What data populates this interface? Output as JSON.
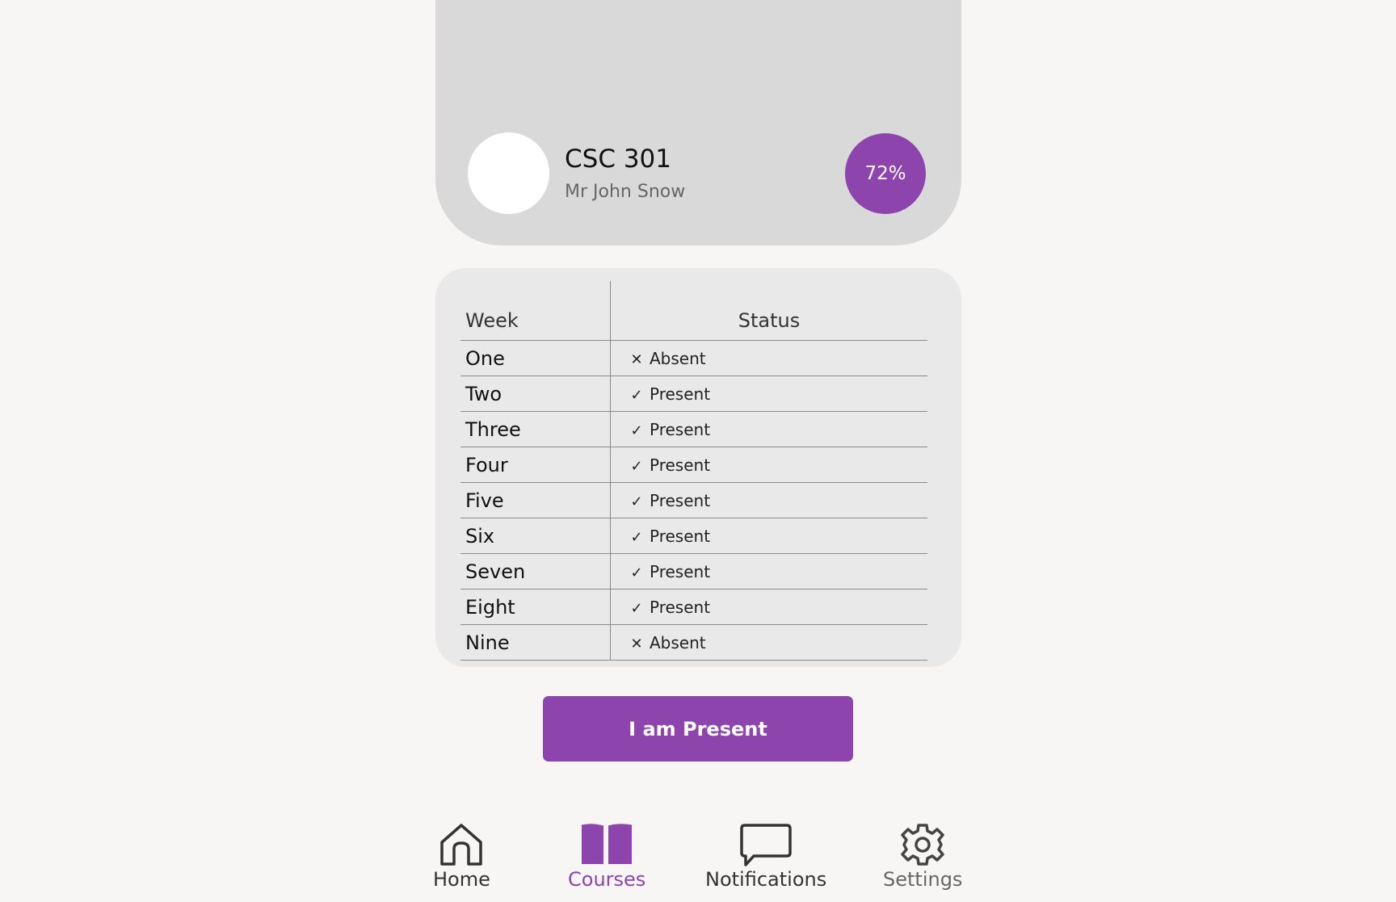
{
  "course": {
    "code": "CSC 301",
    "lecturer": "Mr John Snow",
    "attendance_percent": "72%"
  },
  "table": {
    "headers": {
      "week": "Week",
      "status": "Status"
    },
    "rows": [
      {
        "week": "One",
        "status": "Absent",
        "icon": "x-icon"
      },
      {
        "week": "Two",
        "status": "Present",
        "icon": "check-icon"
      },
      {
        "week": "Three",
        "status": "Present",
        "icon": "check-icon"
      },
      {
        "week": "Four",
        "status": "Present",
        "icon": "check-icon"
      },
      {
        "week": "Five",
        "status": "Present",
        "icon": "check-icon"
      },
      {
        "week": "Six",
        "status": "Present",
        "icon": "check-icon"
      },
      {
        "week": "Seven",
        "status": "Present",
        "icon": "check-icon"
      },
      {
        "week": "Eight",
        "status": "Present",
        "icon": "check-icon"
      },
      {
        "week": "Nine",
        "status": "Absent",
        "icon": "x-icon"
      }
    ]
  },
  "actions": {
    "present_label": "I am Present"
  },
  "nav": {
    "home": "Home",
    "courses": "Courses",
    "notifications": "Notifications",
    "settings": "Settings",
    "active": "courses"
  },
  "colors": {
    "accent": "#8e44ad",
    "card": "#d9d9d9",
    "table_bg": "#e9e9e9",
    "page_bg": "#f7f6f4"
  }
}
